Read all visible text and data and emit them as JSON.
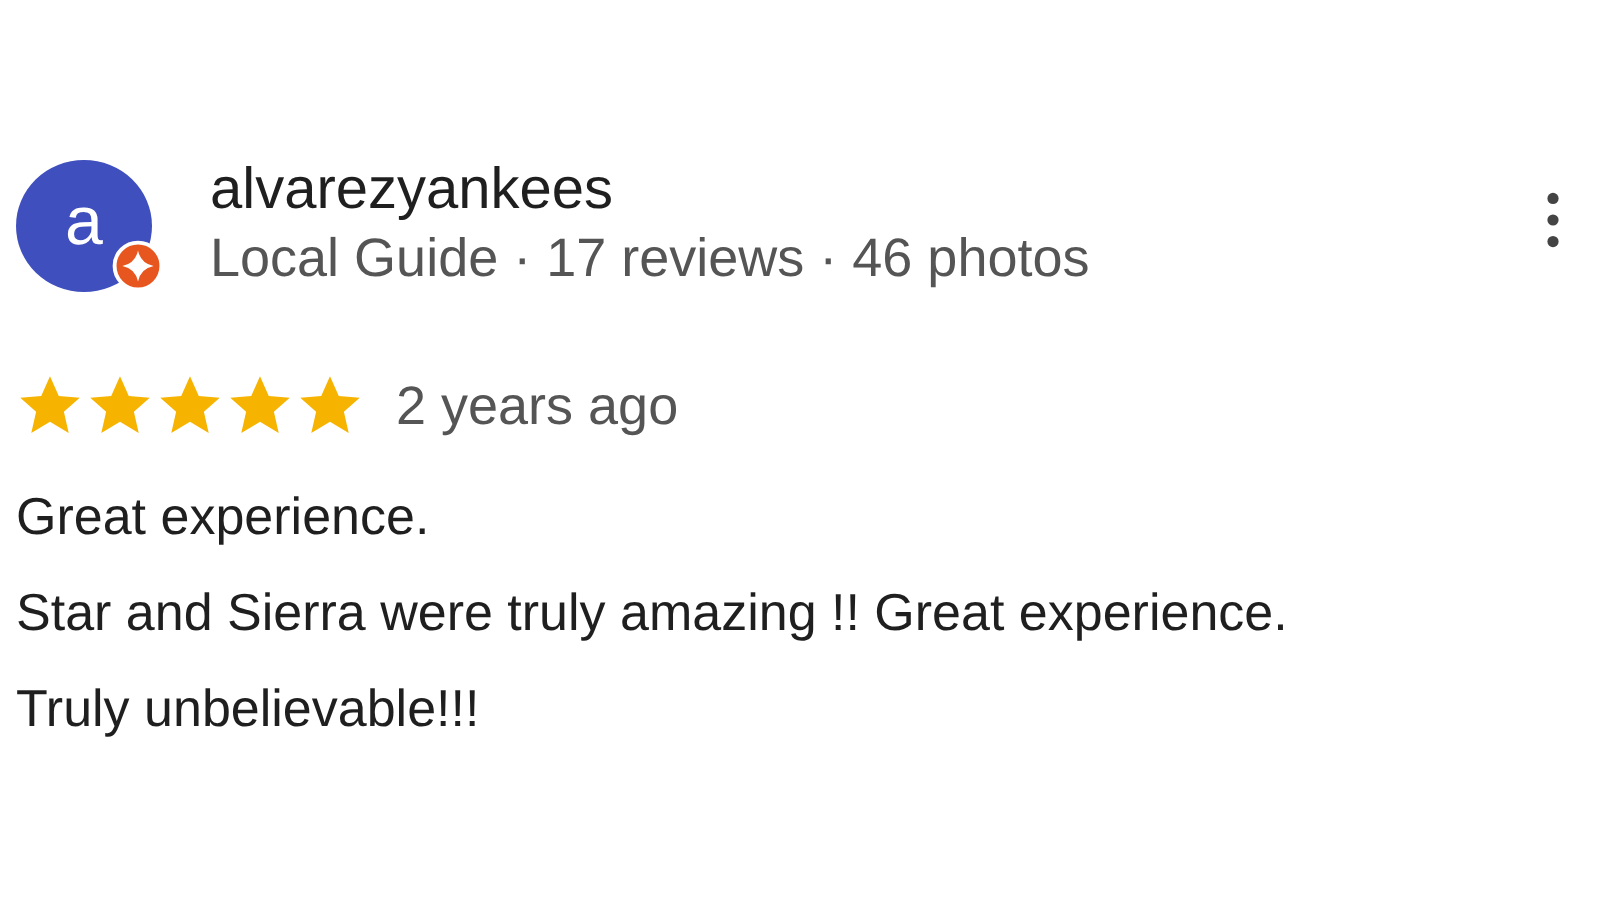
{
  "review": {
    "avatar_initial": "a",
    "local_guide": true,
    "author": "alvarezyankees",
    "author_meta": "Local Guide · 17 reviews · 46 photos",
    "stars": 5,
    "time": "2 years ago",
    "body": [
      "Great experience.",
      "Star and Sierra were truly amazing !! Great experience.",
      "Truly unbelievable!!!"
    ]
  }
}
